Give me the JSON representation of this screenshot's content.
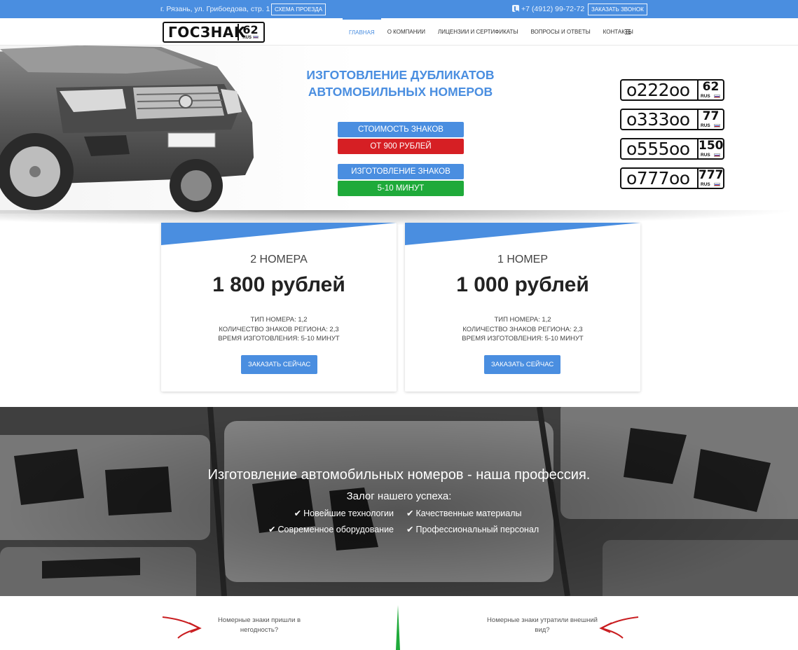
{
  "topbar": {
    "address": "г. Рязань, ул. Грибоедова, стр. 1",
    "map_button": "СХЕМА ПРОЕЗДА",
    "phone": "+7 (4912) 99-72-72",
    "callback_button": "ЗАКАЗАТЬ ЗВОНОК"
  },
  "logo": {
    "text": "ГОСЗНАК",
    "region": "62",
    "rus": "RUS"
  },
  "nav": {
    "items": [
      {
        "label": "ГЛАВНАЯ"
      },
      {
        "label": "О КОМПАНИИ"
      },
      {
        "label": "ЛИЦЕНЗИИ И СЕРТИФИКАТЫ"
      },
      {
        "label": "ВОПРОСЫ И ОТВЕТЫ"
      },
      {
        "label": "КОНТАКТЫ"
      }
    ],
    "active_index": 0,
    "menu_icon": "hamburger-icon"
  },
  "hero": {
    "title_line1": "ИЗГОТОВЛЕНИЕ ДУБЛИКАТОВ",
    "title_line2": "АВТОМОБИЛЬНЫХ НОМЕРОВ",
    "cost_label": "СТОИМОСТЬ ЗНАКОВ",
    "cost_value": "ОТ 900 РУБЛЕЙ",
    "make_label": "ИЗГОТОВЛЕНИЕ ЗНАКОВ",
    "make_value": "5-10 МИНУТ",
    "plates": [
      {
        "number": "о222оо",
        "region": "62",
        "rus": "RUS"
      },
      {
        "number": "о333оо",
        "region": "77",
        "rus": "RUS"
      },
      {
        "number": "о555оо",
        "region": "150",
        "rus": "RUS"
      },
      {
        "number": "о777оо",
        "region": "777",
        "rus": "RUS"
      }
    ]
  },
  "cards": [
    {
      "title": "2 НОМЕРА",
      "price": "1 800 рублей",
      "features": [
        "ТИП НОМЕРА: 1,2",
        "КОЛИЧЕСТВО ЗНАКОВ РЕГИОНА: 2,3",
        "ВРЕМЯ ИЗГОТОВЛЕНИЯ: 5-10 МИНУТ"
      ],
      "button": "ЗАКАЗАТЬ СЕЙЧАС"
    },
    {
      "title": "1 НОМЕР",
      "price": "1 000 рублей",
      "features": [
        "ТИП НОМЕРА: 1,2",
        "КОЛИЧЕСТВО ЗНАКОВ РЕГИОНА: 2,3",
        "ВРЕМЯ ИЗГОТОВЛЕНИЯ: 5-10 МИНУТ"
      ],
      "button": "ЗАКАЗАТЬ СЕЙЧАС"
    }
  ],
  "banner": {
    "heading": "Изготовление автомобильных номеров - наша профессия.",
    "subheading": "Залог нашего успеха:",
    "check": "✔",
    "advantages": [
      "Новейшие технологии",
      "Качественные материалы",
      "Современное оборудование",
      "Профессиональный персонал"
    ]
  },
  "bottom": {
    "left_question": "Номерные знаки пришли в негодность?",
    "right_question": "Номерные знаки утратили внешний вид?"
  },
  "colors": {
    "accent": "#4a8ee0",
    "red": "#d61f24",
    "green": "#1faa3a",
    "arrow_red": "#c91d20",
    "divider_green": "#1faa3a"
  }
}
